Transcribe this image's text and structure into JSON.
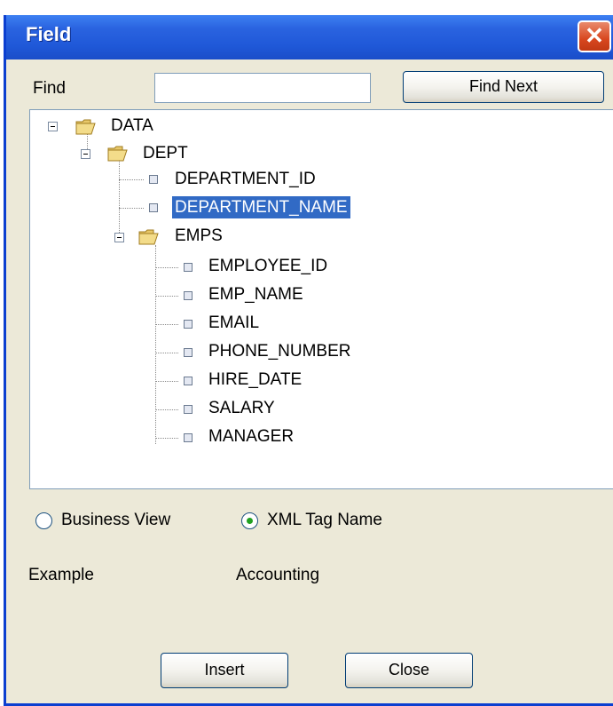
{
  "window": {
    "title": "Field",
    "close_glyph": "✕"
  },
  "find": {
    "label": "Find",
    "value": "",
    "button_label": "Find Next"
  },
  "tree": {
    "root": "DATA",
    "dept": "DEPT",
    "dept_fields": [
      "DEPARTMENT_ID",
      "DEPARTMENT_NAME"
    ],
    "selected": "DEPARTMENT_NAME",
    "emps": "EMPS",
    "emp_fields": [
      "EMPLOYEE_ID",
      "EMP_NAME",
      "EMAIL",
      "PHONE_NUMBER",
      "HIRE_DATE",
      "SALARY",
      "MANAGER"
    ]
  },
  "view_mode": {
    "options": [
      "Business View",
      "XML Tag Name"
    ],
    "selected": "XML Tag Name"
  },
  "example": {
    "label": "Example",
    "value": "Accounting"
  },
  "buttons": {
    "insert": "Insert",
    "close": "Close"
  },
  "colors": {
    "selection": "#316ac5",
    "titlebar": "#2a63e0",
    "dialog_bg": "#ece9d8"
  }
}
